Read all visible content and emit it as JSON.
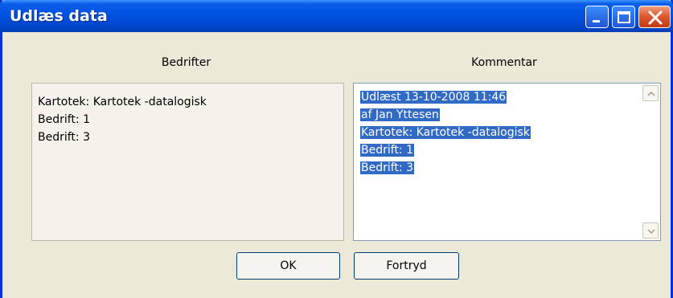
{
  "window": {
    "title": "Udlæs data",
    "controls": [
      "minimize-icon",
      "maximize-icon",
      "close-icon"
    ]
  },
  "left": {
    "label": "Bedrifter",
    "lines": [
      "Kartotek: Kartotek -datalogisk",
      "Bedrift: 1",
      "Bedrift: 3"
    ]
  },
  "right": {
    "label": "Kommentar",
    "lines": [
      "Udlæst 13-10-2008 11:46",
      "af Jan Yttesen",
      "Kartotek: Kartotek -datalogisk",
      "Bedrift: 1",
      "Bedrift: 3"
    ],
    "selection_color": "#316AC5"
  },
  "buttons": {
    "ok": "OK",
    "cancel": "Fortryd"
  },
  "colors": {
    "titlebar": "#0054E3",
    "window_bg": "#ECE9D8",
    "close_button": "#E05A30"
  }
}
